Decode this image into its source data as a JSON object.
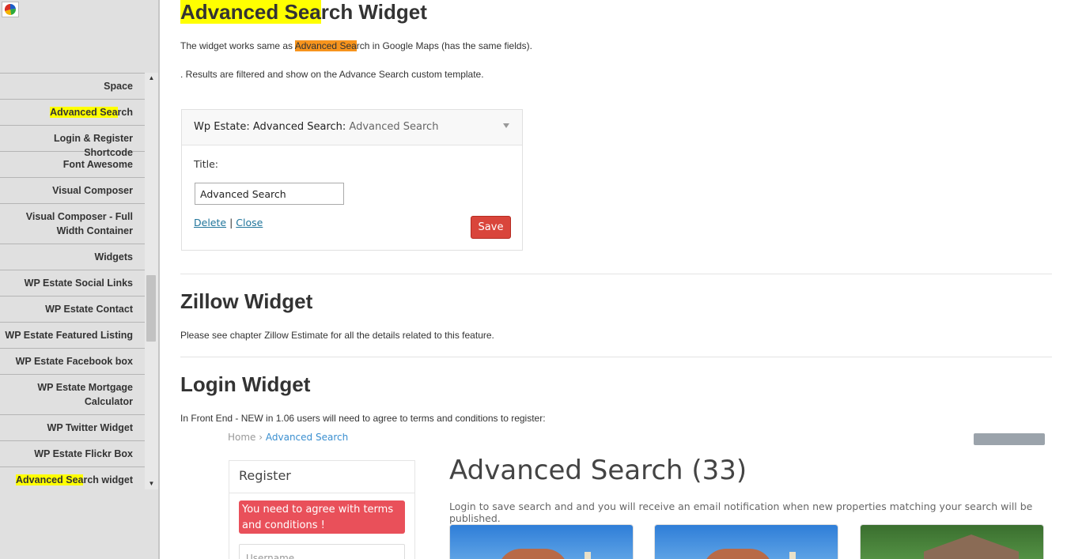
{
  "sidebar": {
    "app_icon": "pie-chart-icon",
    "items": [
      {
        "pre": "Space",
        "hl": "",
        "post": ""
      },
      {
        "pre": "",
        "hl": "Advanced Sea",
        "post": "rch"
      },
      {
        "pre": "Login & Register Shortcode",
        "hl": "",
        "post": ""
      },
      {
        "pre": "Font Awesome",
        "hl": "",
        "post": ""
      },
      {
        "pre": "Visual Composer",
        "hl": "",
        "post": ""
      },
      {
        "pre": "Visual Composer - Full Width Container",
        "hl": "",
        "post": ""
      },
      {
        "pre": "Widgets",
        "hl": "",
        "post": ""
      },
      {
        "pre": "WP Estate Social Links",
        "hl": "",
        "post": ""
      },
      {
        "pre": "WP Estate Contact",
        "hl": "",
        "post": ""
      },
      {
        "pre": "WP Estate Featured Listing",
        "hl": "",
        "post": ""
      },
      {
        "pre": "WP Estate Facebook box",
        "hl": "",
        "post": ""
      },
      {
        "pre": "WP Estate Mortgage Calculator",
        "hl": "",
        "post": ""
      },
      {
        "pre": "WP Twitter Widget",
        "hl": "",
        "post": ""
      },
      {
        "pre": "WP Estate Flickr Box",
        "hl": "",
        "post": ""
      },
      {
        "pre": "",
        "hl": "Advanced Sea",
        "post": "rch widget"
      }
    ]
  },
  "section_adv": {
    "title_hl": "Advanced Sea",
    "title_rest": "rch Widget",
    "p1_pre": "The widget works same as ",
    "p1_hl": "Advanced Sea",
    "p1_post": "rch in Google Maps (has the same fields).",
    "p2": ". Results are filtered and show on the Advance Search custom template."
  },
  "widget": {
    "title_main": "Wp Estate: Advanced Search:",
    "title_sub": " Advanced Search",
    "field_label": "Title:",
    "field_value": "Advanced Search",
    "delete_label": "Delete",
    "separator": "|",
    "close_label": "Close",
    "save_label": "Save"
  },
  "section_zillow": {
    "title": "Zillow Widget",
    "text": "Please see chapter Zillow Estimate for all the details related to this feature."
  },
  "section_login": {
    "title": "Login Widget",
    "text": "In Front End - NEW in 1.06 users will need to agree to terms and conditions to register:"
  },
  "embedded": {
    "breadcrumb_home": "Home",
    "breadcrumb_sep": " › ",
    "breadcrumb_current": "Advanced Search",
    "register_title": "Register",
    "alert_text": "You need to agree with terms and conditions !",
    "username_placeholder": "Username",
    "page_title": "Advanced Search (33)",
    "description": "Login to save search and and you will receive an email notification when new properties matching your search will be published."
  }
}
